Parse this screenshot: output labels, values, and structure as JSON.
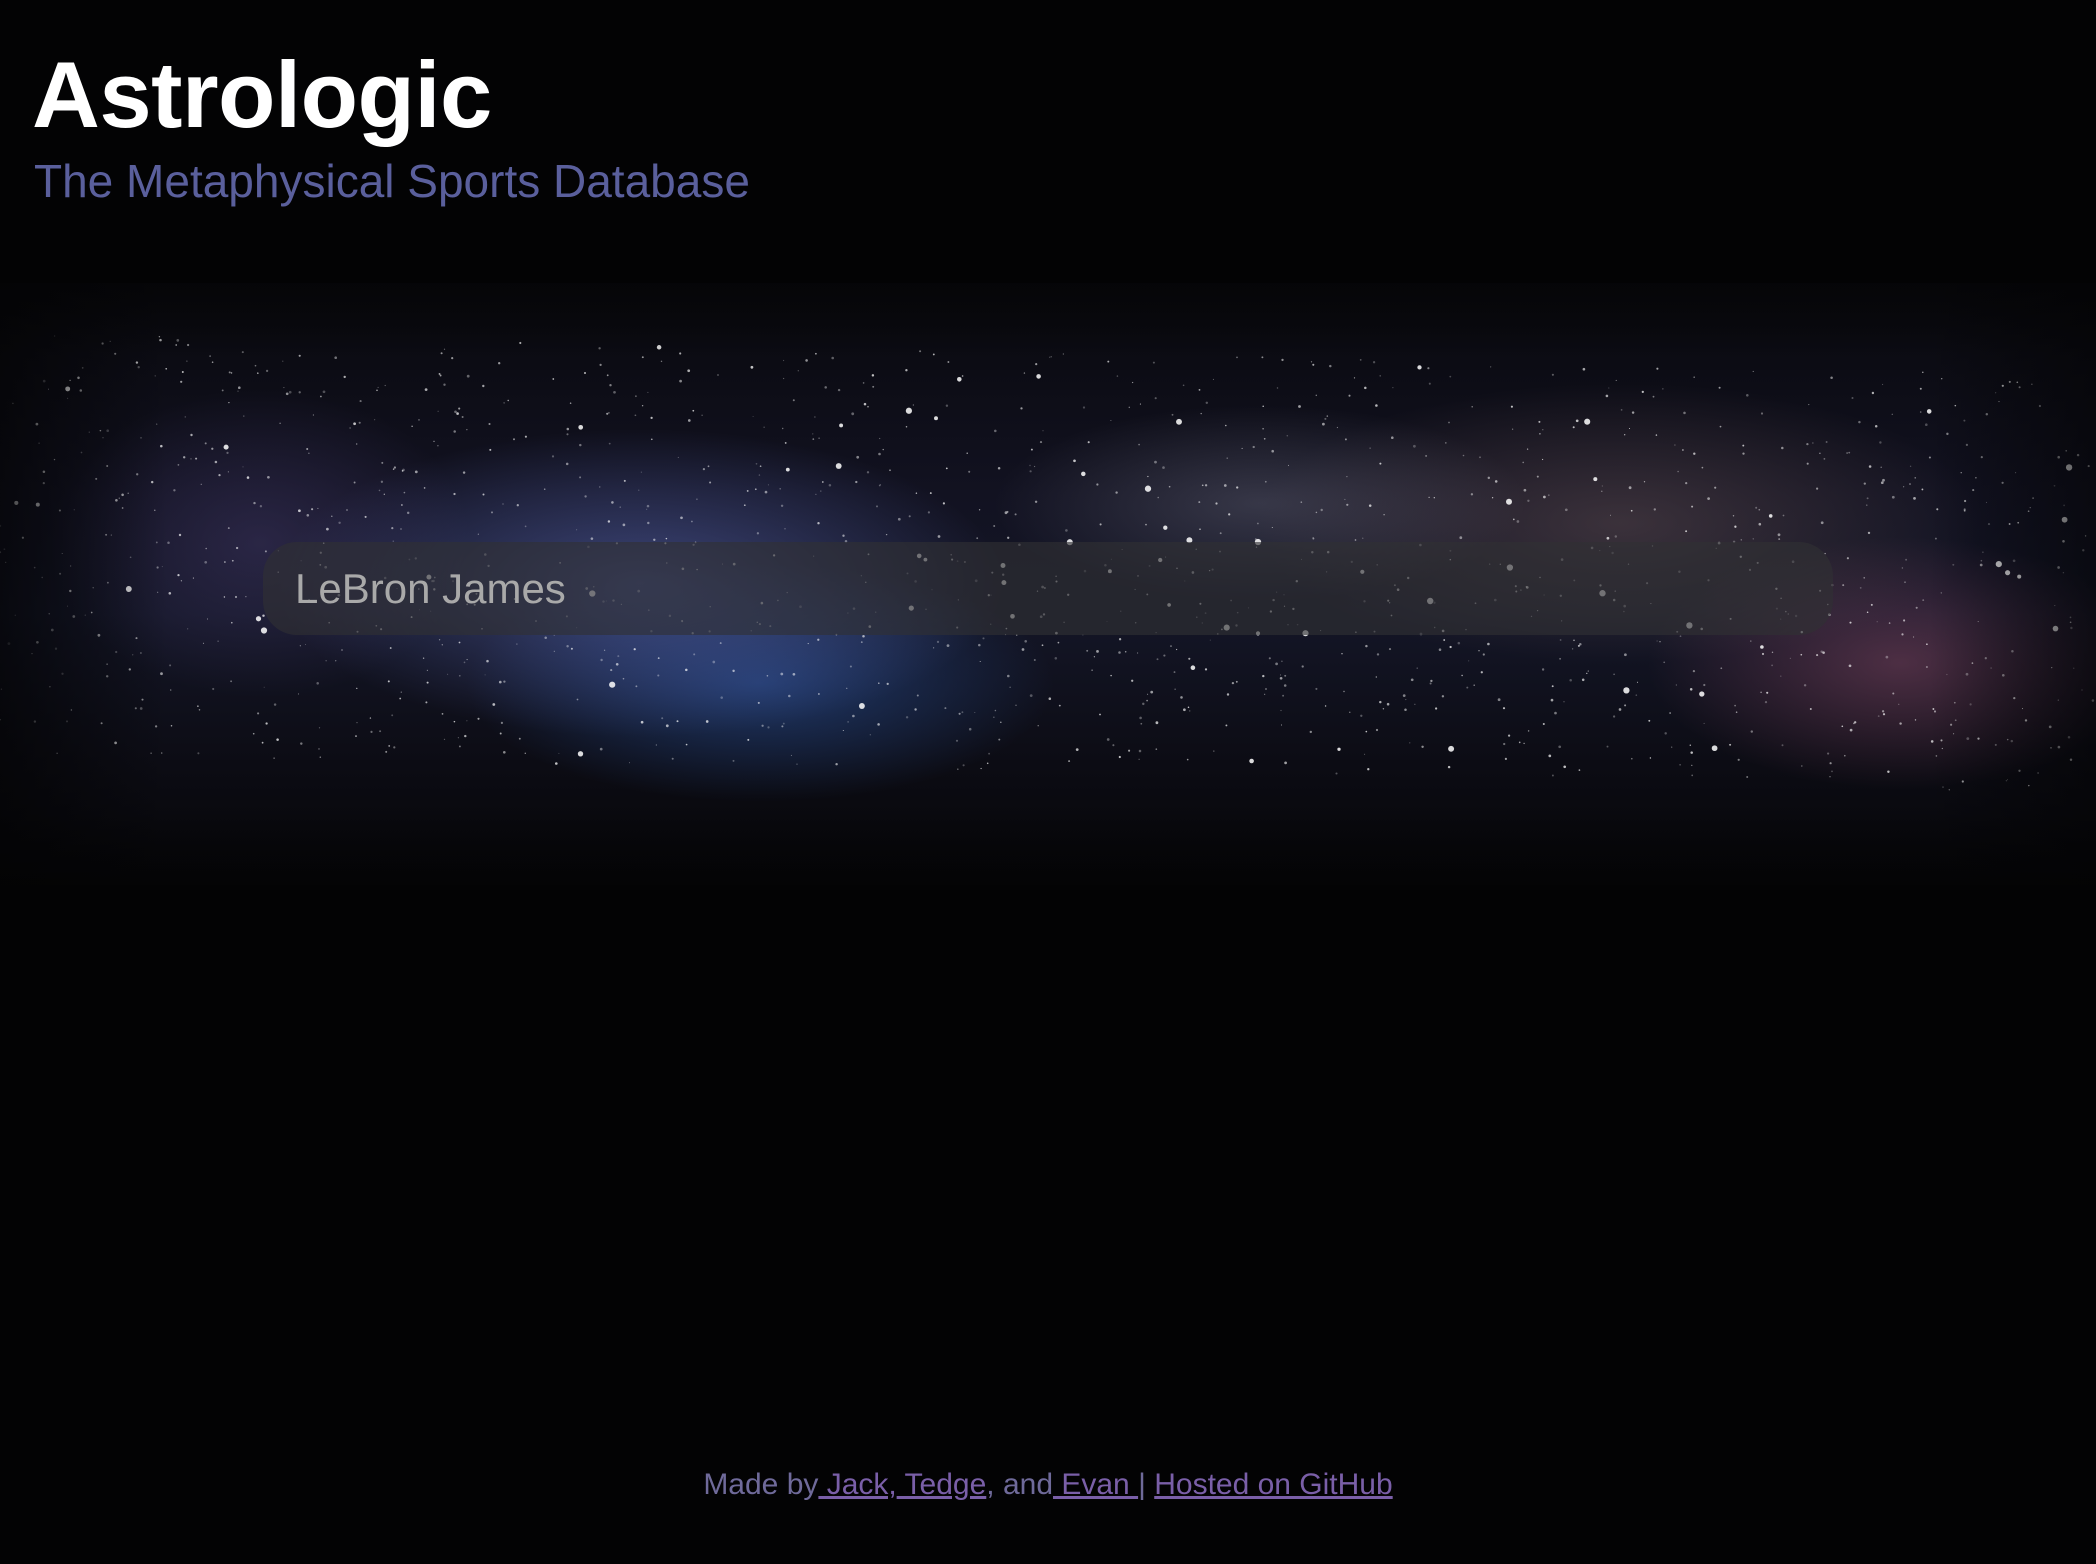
{
  "header": {
    "title": "Astrologic",
    "subtitle": "The Metaphysical Sports Database"
  },
  "search": {
    "placeholder": "LeBron James",
    "value": ""
  },
  "footer": {
    "made_by": "Made by",
    "author_1": " Jack,",
    "author_2": " Tedge",
    "and_text": ", and",
    "author_3": " Evan ",
    "separator": "|",
    "hosted_link": "Hosted on GitHub"
  },
  "colors": {
    "background": "#030304",
    "title": "#ffffff",
    "subtitle": "#5a5f9c",
    "footer_text": "#6f6a9a",
    "footer_link": "#7a5fa8"
  }
}
